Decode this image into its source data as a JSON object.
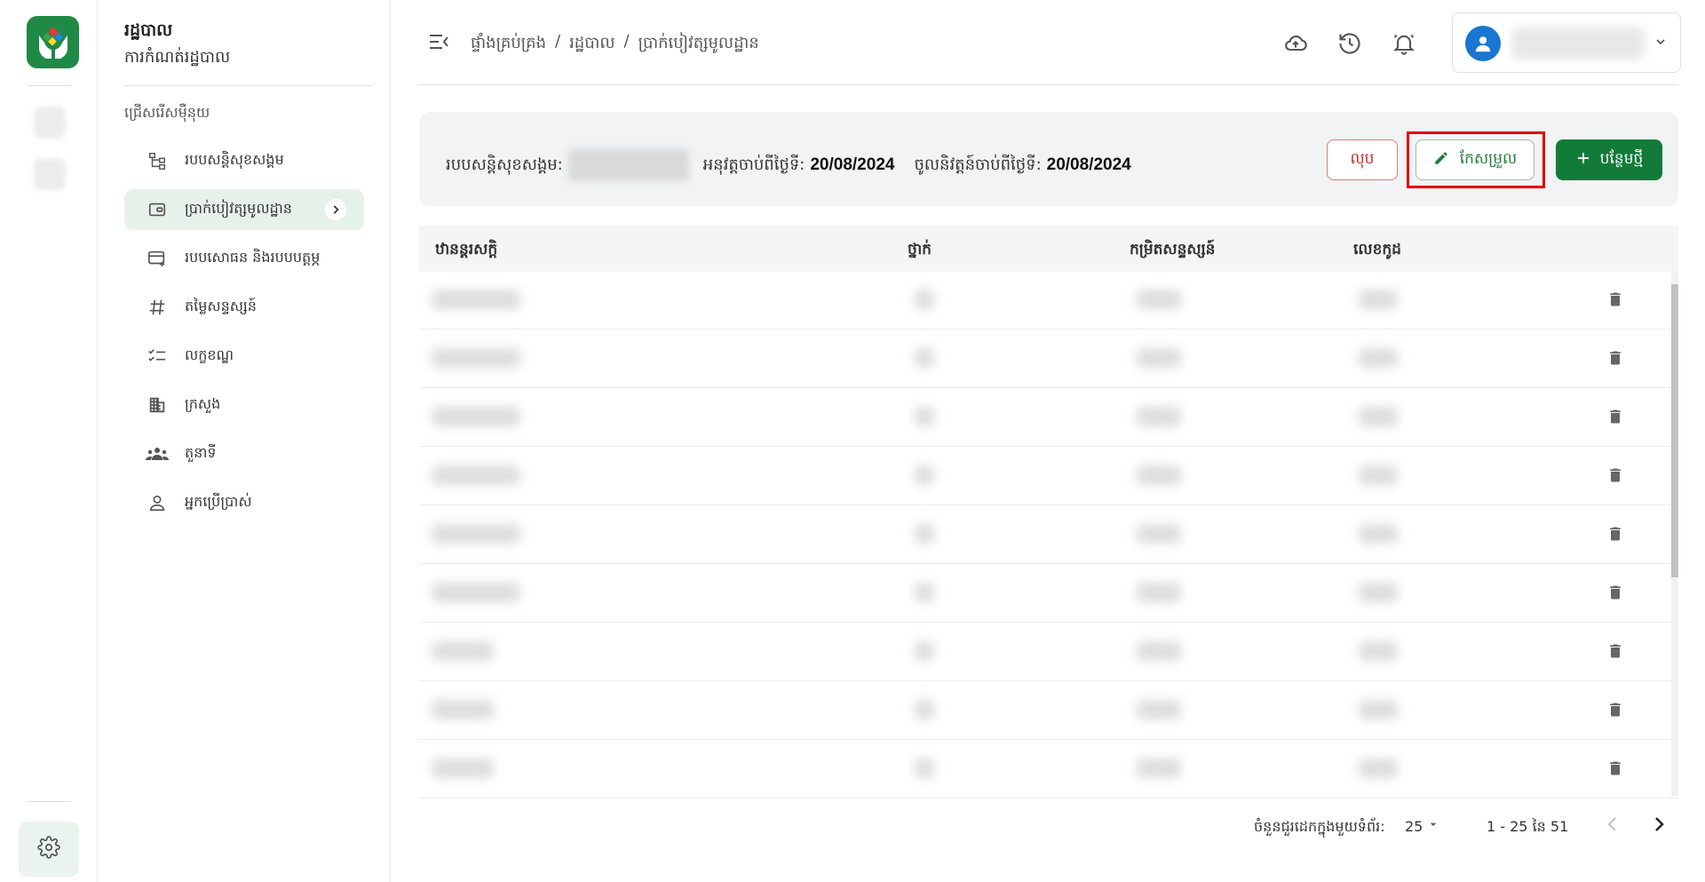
{
  "rail": {
    "logo_icon": "hands-care-logo",
    "settings_icon": "gear-icon"
  },
  "sidebar": {
    "title": "រដ្ឋបាល",
    "subtitle": "ការកំណត់រដ្ឋបាល",
    "choose_label": "ជ្រើសរើសម៉ឺនុយ",
    "items": [
      {
        "label": "របបសន្តិសុខសង្គម",
        "icon": "hierarchy-icon",
        "active": false
      },
      {
        "label": "ប្រាក់បៀវត្សមូលដ្ឋាន",
        "icon": "wallet-icon",
        "active": true
      },
      {
        "label": "របបសោធន និងរបបបត្តម្ភ",
        "icon": "card-add-icon",
        "active": false
      },
      {
        "label": "តម្លៃសន្ទស្សន៍",
        "icon": "hash-icon",
        "active": false
      },
      {
        "label": "លក្ខខណ្ឌ",
        "icon": "checklist-icon",
        "active": false
      },
      {
        "label": "ក្រសួង",
        "icon": "building-icon",
        "active": false
      },
      {
        "label": "តួនាទី",
        "icon": "group-icon",
        "active": false
      },
      {
        "label": "អ្នកប្រើប្រាស់",
        "icon": "person-icon",
        "active": false
      }
    ]
  },
  "topbar": {
    "breadcrumb": [
      "ផ្ទាំងគ្រប់គ្រង",
      "/",
      "រដ្ឋបាល",
      "/",
      "ប្រាក់បៀវត្សមូលដ្ឋាន"
    ],
    "icons": [
      "cloud-upload-icon",
      "history-icon",
      "bell-icon"
    ]
  },
  "info": {
    "scheme_label": "របបសន្តិសុខសង្គម:",
    "effective_label": "អនុវត្តចាប់ពីថ្ងៃទី:",
    "effective_date": "20/08/2024",
    "entry_label": "ចូលនិវត្តន៍ចាប់ពីថ្ងៃទី:",
    "entry_date": "20/08/2024",
    "delete_label": "លុប",
    "edit_label": "កែសម្រួល",
    "add_label": "បន្ថែមថ្មី"
  },
  "table": {
    "headers": [
      "ឋានន្តរសក្តិ",
      "ថ្នាក់",
      "កម្រិតសន្ទស្សន៍",
      "លេខកូដ"
    ],
    "row_count_visible": 9
  },
  "pager": {
    "rows_per_page_label": "ចំនួនជួរដេកក្នុងមួយទំព័រ:",
    "rows_per_page": "25",
    "range": "1 - 25 នៃ 51"
  },
  "colors": {
    "brand_green": "#137b3a",
    "danger_red": "#c62828",
    "highlight_red": "#e50000",
    "avatar_blue": "#1976d2"
  }
}
